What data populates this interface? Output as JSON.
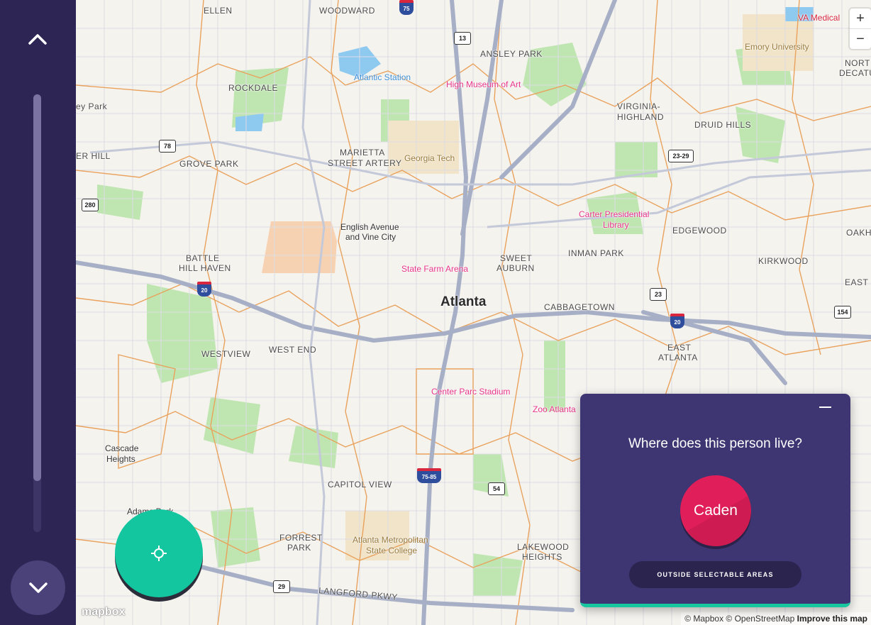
{
  "nav": {
    "up_icon": "chevron-up-icon",
    "down_icon": "chevron-down-icon"
  },
  "map": {
    "neighborhoods": [
      "ELLEN",
      "WOODWARD",
      "ANSLEY PARK",
      "ROCKDALE",
      "ey Park",
      "VIRGINIA-",
      "HIGHLAND",
      "DRUID HILLS",
      "ER HILL",
      "GROVE PARK",
      "MARIETTA",
      "STREET ARTERY",
      "English Avenue",
      "and Vine City",
      "BATTLE",
      "HILL HAVEN",
      "SWEET",
      "AUBURN",
      "INMAN PARK",
      "EDGEWOOD",
      "OAKH",
      "KIRKWOOD",
      "CABBAGETOWN",
      "EAST",
      "WESTVIEW",
      "WEST END",
      "EAST",
      "ATLANTA",
      "Cascade",
      "Heights",
      "CAPITOL VIEW",
      "Adams Park",
      "FORREST",
      "PARK",
      "LAKEWOOD",
      "HEIGHTS",
      "LANGFORD PKWY",
      "NORT",
      "DECATU"
    ],
    "city": "Atlanta",
    "pois": [
      "High Museum of Art",
      "Carter Presidential",
      "Library",
      "State Farm Arena",
      "Center Parc Stadium",
      "Zoo Atlanta",
      "VA Medical"
    ],
    "pois_tan": [
      "Georgia Tech",
      "Emory University",
      "Atlanta Metropolitan",
      "State College"
    ],
    "water": [
      "Atlantic Station"
    ],
    "route_shields": [
      "13",
      "78",
      "280",
      "23-29",
      "23",
      "154",
      "29",
      "54"
    ],
    "interstate_shields": [
      "20",
      "20",
      "75-85",
      "75"
    ],
    "zoom_in": "+",
    "zoom_out": "−",
    "logo": "mapbox",
    "attribution_text": "© Mapbox © OpenStreetMap",
    "attribution_link": "Improve this map",
    "locate_icon": "crosshair-icon"
  },
  "panel": {
    "question": "Where does this person live?",
    "person_name": "Caden",
    "outside_label": "OUTSIDE SELECTABLE AREAS",
    "minimize_icon": "minimize-icon",
    "accent": "#18c7a0",
    "button_color": "#e01e5a",
    "background": "#3e3573"
  }
}
